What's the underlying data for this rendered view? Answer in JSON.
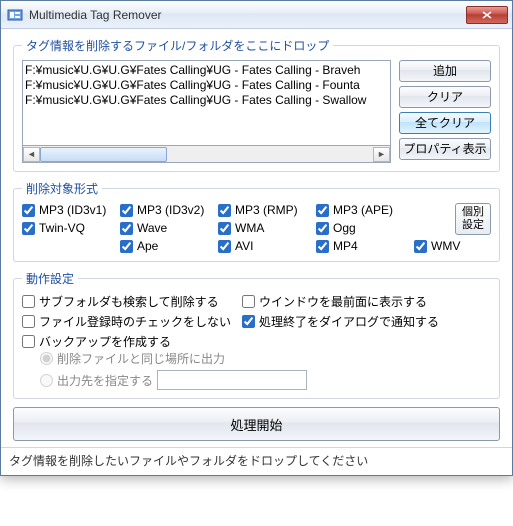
{
  "window": {
    "title": "Multimedia Tag Remover"
  },
  "drop": {
    "legend": "タグ情報を削除するファイル/フォルダをここにドロップ",
    "paths": [
      "F:¥music¥U.G¥U.G¥Fates Calling¥UG - Fates Calling - Braveh",
      "F:¥music¥U.G¥U.G¥Fates Calling¥UG - Fates Calling - Founta",
      "F:¥music¥U.G¥U.G¥Fates Calling¥UG - Fates Calling - Swallow"
    ]
  },
  "buttons": {
    "add": "追加",
    "clear": "クリア",
    "clear_all": "全てクリア",
    "properties": "プロパティ表示",
    "individual": "個別\n設定",
    "start": "処理開始"
  },
  "formats": {
    "legend": "削除対象形式",
    "items": [
      {
        "label": "MP3 (ID3v1)",
        "checked": true
      },
      {
        "label": "MP3 (ID3v2)",
        "checked": true
      },
      {
        "label": "MP3 (RMP)",
        "checked": true
      },
      {
        "label": "MP3 (APE)",
        "checked": true
      },
      {
        "label": "Twin-VQ",
        "checked": true
      },
      {
        "label": "Wave",
        "checked": true
      },
      {
        "label": "WMA",
        "checked": true
      },
      {
        "label": "Ogg",
        "checked": true
      },
      {
        "label": "Ape",
        "checked": true
      },
      {
        "label": "AVI",
        "checked": true
      },
      {
        "label": "MP4",
        "checked": true
      },
      {
        "label": "WMV",
        "checked": true
      }
    ]
  },
  "behavior": {
    "legend": "動作設定",
    "subfolder": {
      "label": "サブフォルダも検索して削除する",
      "checked": false
    },
    "topmost": {
      "label": "ウインドウを最前面に表示する",
      "checked": false
    },
    "nocheck": {
      "label": "ファイル登録時のチェックをしない",
      "checked": false
    },
    "notify": {
      "label": "処理終了をダイアログで通知する",
      "checked": true
    },
    "backup": {
      "label": "バックアップを作成する",
      "checked": false
    },
    "out_same": "削除ファイルと同じ場所に出力",
    "out_spec": "出力先を指定する",
    "out_path": ""
  },
  "status": "タグ情報を削除したいファイルやフォルダをドロップしてください"
}
